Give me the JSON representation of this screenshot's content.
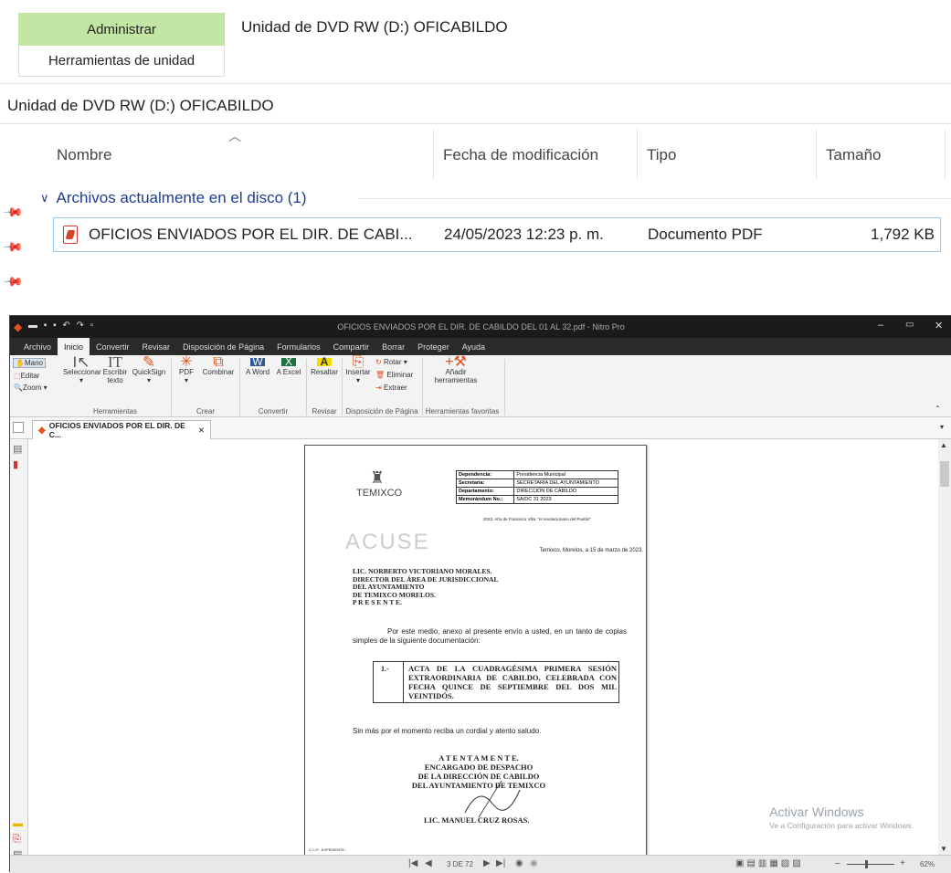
{
  "explorer": {
    "ribbon_tab_active": "Administrar",
    "ribbon_tab_context": "Herramientas de unidad",
    "window_title": "Unidad de DVD RW (D:) OFICABILDO",
    "address": "Unidad de DVD RW (D:) OFICABILDO",
    "columns": [
      "Nombre",
      "Fecha de modificación",
      "Tipo",
      "Tamaño"
    ],
    "group_label": "Archivos actualmente en el disco (1)",
    "file": {
      "name": "OFICIOS ENVIADOS POR EL DIR. DE CABI...",
      "date": "24/05/2023 12:23 p. m.",
      "type": "Documento PDF",
      "size": "1,792 KB"
    }
  },
  "nitro": {
    "title": "OFICIOS ENVIADOS POR EL DIR. DE CABILDO DEL 01 AL 32.pdf - Nitro Pro",
    "menu": [
      "Archivo",
      "Inicio",
      "Convertir",
      "Revisar",
      "Disposición de Página",
      "Formularios",
      "Compartir",
      "Borrar",
      "Proteger",
      "Ayuda"
    ],
    "ribbon": {
      "mano": "Mano",
      "editar": "Editar",
      "zoom": "Zoom",
      "seleccionar": "Seleccionar",
      "escribir": "Escribir texto",
      "quicksign": "QuickSign",
      "herramientas": "Herramientas",
      "pdf": "PDF",
      "combinar": "Combinar",
      "crear": "Crear",
      "a_word": "A Word",
      "a_excel": "A Excel",
      "convertir": "Convertir",
      "resaltar": "Resaltar",
      "revisar": "Revisar",
      "insertar": "Insertar",
      "rotar": "Rotar",
      "eliminar": "Eliminar",
      "extraer": "Extraer",
      "disposicion": "Disposición de Página",
      "anadir": "Añadir herramientas",
      "favoritas": "Herramientas favoritas"
    },
    "doc_tab": "OFICIOS ENVIADOS POR EL DIR. DE C...",
    "page_indicator": "3 DE 72",
    "zoom": "62%",
    "watermark_title": "Activar Windows",
    "watermark_sub": "Ve a Configuración para activar Windows."
  },
  "document": {
    "logo_text": "TEMIXCO",
    "table": [
      [
        "Dependencia:",
        "Presidencia Municipal"
      ],
      [
        "Secretaría:",
        "SECRETARÍA DEL AYUNTAMIENTO"
      ],
      [
        "Departamento:",
        "DIRECCIÓN DE CABILDO"
      ],
      [
        "Memorándum No.:",
        "SA/DC    31    2023"
      ]
    ],
    "motto": "2023, Año de Francisco Villa, \"el revolucionario del Pueblo\"",
    "stamp": "ACUSE",
    "place_date": "Temixco, Morelos, a 15 de marzo de 2023.",
    "addressee": [
      "LIC. NORBERTO VICTORIANO MORALES.",
      "DIRECTOR DEL ÁREA DE JURISDICCIONAL",
      "DEL AYUNTAMIENTO",
      "DE TEMIXCO MORELOS.",
      "P R E S E N T E."
    ],
    "body": "Por este medio, anexo al presente envío a usted, en un tanto de copias simples de la siguiente documentación:",
    "item_num": "1.-",
    "item_text": "ACTA DE LA CUADRAGÉSIMA PRIMERA SESIÓN EXTRAORDINARIA DE CABILDO, CELEBRADA CON FECHA QUINCE DE SEPTIEMBRE DEL DOS MIL VEINTIDÓS.",
    "closing": "Sin más por el momento reciba un cordial y atento saludo.",
    "sign_block": [
      "A T E N T A M E N T E.",
      "ENCARGADO DE DESPACHO",
      "DE LA DIRECCIÓN DE CABILDO",
      "DEL AYUNTAMIENTO DE TEMIXCO"
    ],
    "signer": "LIC. MANUEL CRUZ ROSAS.",
    "ccp": "C.C.P.- EXPEDIENTE.-"
  }
}
